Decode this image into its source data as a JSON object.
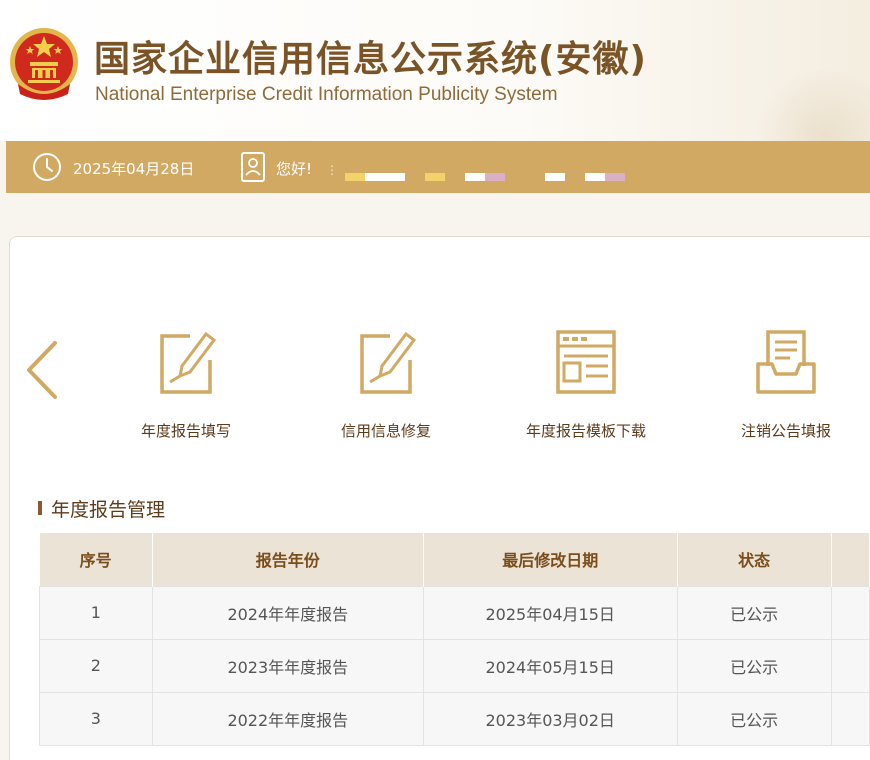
{
  "header": {
    "title_cn": "国家企业信用信息公示系统(安徽)",
    "title_en": "National Enterprise Credit Information Publicity System",
    "emblem_icon": "national-emblem-icon"
  },
  "topbar": {
    "date": "2025年04月28日",
    "greeting": "您好!",
    "username_masked": "⋮",
    "clock_icon": "clock-icon",
    "user_icon": "user-card-icon",
    "bg_color": "#d1a963"
  },
  "nav": {
    "prev_icon": "chevron-left-icon",
    "tiles": [
      {
        "label": "年度报告填写",
        "icon": "edit-document-icon"
      },
      {
        "label": "信用信息修复",
        "icon": "edit-document-icon"
      },
      {
        "label": "年度报告模板下载",
        "icon": "template-download-icon"
      },
      {
        "label": "注销公告填报",
        "icon": "inbox-document-icon"
      }
    ]
  },
  "reports": {
    "title": "年度报告管理",
    "columns": [
      "序号",
      "报告年份",
      "最后修改日期",
      "状态"
    ],
    "rows": [
      {
        "index": "1",
        "year": "2024年年度报告",
        "modified": "2025年04月15日",
        "status": "已公示"
      },
      {
        "index": "2",
        "year": "2023年年度报告",
        "modified": "2024年05月15日",
        "status": "已公示"
      },
      {
        "index": "3",
        "year": "2022年年度报告",
        "modified": "2023年03月02日",
        "status": "已公示"
      }
    ]
  },
  "colors": {
    "accent_gold": "#d1a963",
    "title_brown": "#7a5426",
    "table_header_bg": "#ece3d7"
  }
}
